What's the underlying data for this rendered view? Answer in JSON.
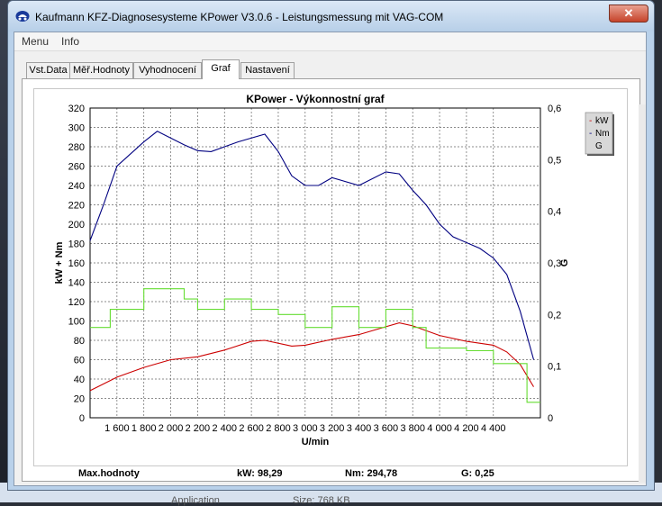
{
  "window": {
    "title": "Kaufmann KFZ-Diagnosesysteme  KPower V3.0.6 - Leistungsmessung mit VAG-COM",
    "close_symbol": "✕"
  },
  "menu": [
    "Menu",
    "Info"
  ],
  "tabs": [
    "Vst.Data",
    "Měř.Hodnoty",
    "Vyhodnocení",
    "Graf",
    "Nastavení"
  ],
  "active_tab": "Graf",
  "footer": {
    "max_label": "Max.hodnoty",
    "kw": "kW: 98,29",
    "nm": "Nm: 294,78",
    "g": "G: 0,25"
  },
  "background_text": {
    "left": "Application",
    "right": "Size: 768 KB"
  },
  "colors": {
    "kW": "#cc0000",
    "Nm": "#000080",
    "G": "#66dd33",
    "grid": "#666666"
  },
  "icons": {
    "app": "car-logo-icon",
    "close": "close-icon"
  },
  "chart_data": {
    "type": "line",
    "title": "KPower - Výkonnostní graf",
    "xlabel": "U/min",
    "ylabel": "kW + Nm",
    "y2label": "G",
    "xlim": [
      1400,
      4750
    ],
    "ylim": [
      0,
      320
    ],
    "y2lim": [
      0,
      0.6
    ],
    "x_ticks": [
      "1 600",
      "1 800",
      "2 000",
      "2 200",
      "2 400",
      "2 600",
      "2 800",
      "3 000",
      "3 200",
      "3 400",
      "3 600",
      "3 800",
      "4 000",
      "4 200",
      "4 400"
    ],
    "y_ticks": [
      "0",
      "20",
      "40",
      "60",
      "80",
      "100",
      "120",
      "140",
      "160",
      "180",
      "200",
      "220",
      "240",
      "260",
      "280",
      "300",
      "320"
    ],
    "y2_ticks": [
      "0",
      "0,1",
      "0,2",
      "0,3",
      "0,4",
      "0,5",
      "0,6"
    ],
    "grid": true,
    "legend": {
      "placement": "right",
      "entries": [
        "kW",
        "Nm",
        "G"
      ]
    },
    "series": [
      {
        "name": "kW",
        "axis": "left",
        "x": [
          1400,
          1600,
          1800,
          2000,
          2200,
          2400,
          2600,
          2700,
          2900,
          3000,
          3200,
          3400,
          3600,
          3700,
          3800,
          4000,
          4200,
          4400,
          4500,
          4600,
          4700
        ],
        "y": [
          28,
          42,
          52,
          60,
          63,
          70,
          79,
          80,
          74,
          75,
          81,
          86,
          94,
          98,
          95,
          85,
          79,
          75,
          68,
          55,
          32
        ]
      },
      {
        "name": "Nm",
        "axis": "left",
        "x": [
          1400,
          1500,
          1600,
          1800,
          1900,
          2100,
          2200,
          2300,
          2500,
          2700,
          2800,
          2900,
          3000,
          3100,
          3200,
          3400,
          3600,
          3700,
          3800,
          3900,
          4000,
          4100,
          4300,
          4400,
          4500,
          4600,
          4700
        ],
        "y": [
          183,
          220,
          260,
          285,
          296,
          282,
          276,
          275,
          285,
          293,
          275,
          250,
          240,
          240,
          248,
          240,
          254,
          252,
          235,
          220,
          200,
          187,
          175,
          165,
          148,
          110,
          60
        ]
      },
      {
        "name": "G",
        "axis": "right",
        "x": [
          1400,
          1550,
          1550,
          1800,
          1800,
          2100,
          2100,
          2200,
          2200,
          2400,
          2400,
          2600,
          2600,
          2800,
          2800,
          3000,
          3000,
          3200,
          3200,
          3400,
          3400,
          3600,
          3600,
          3800,
          3800,
          3900,
          3900,
          4200,
          4200,
          4400,
          4400,
          4500,
          4500,
          4650,
          4650,
          4750
        ],
        "y": [
          0.175,
          0.175,
          0.21,
          0.21,
          0.25,
          0.25,
          0.23,
          0.23,
          0.21,
          0.21,
          0.23,
          0.23,
          0.21,
          0.21,
          0.2,
          0.2,
          0.175,
          0.175,
          0.215,
          0.215,
          0.175,
          0.175,
          0.21,
          0.21,
          0.175,
          0.175,
          0.135,
          0.135,
          0.13,
          0.13,
          0.105,
          0.105,
          0.105,
          0.105,
          0.03,
          0.03
        ]
      }
    ]
  }
}
